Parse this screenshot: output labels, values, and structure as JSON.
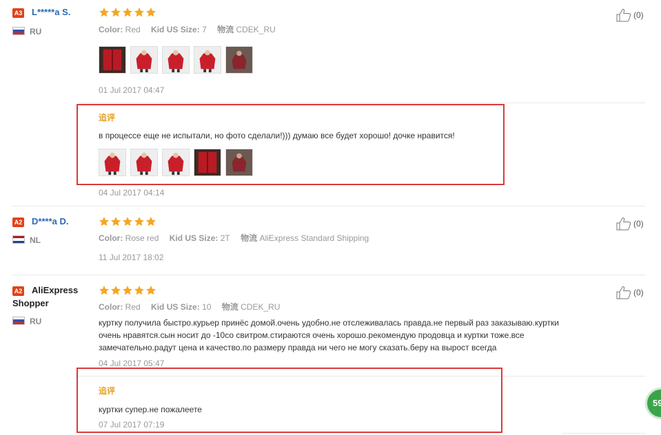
{
  "reviews": [
    {
      "badge": "A3",
      "username": "L*****a S.",
      "country": "RU",
      "meta": {
        "color_label": "Color:",
        "color": "Red",
        "size_label": "Kid US Size:",
        "size": "7",
        "ship_label": "物流",
        "ship": "CDEK_RU"
      },
      "date": "01 Jul 2017 04:47",
      "likes": "(0)",
      "followup": {
        "label": "追评",
        "text": "в процессе еще не испытали, но фото сделали!))) думаю все будет хорошо! дочке нравится!",
        "date": "04 Jul 2017 04:14"
      }
    },
    {
      "badge": "A2",
      "username": "D****a D.",
      "country": "NL",
      "meta": {
        "color_label": "Color:",
        "color": "Rose red",
        "size_label": "Kid US Size:",
        "size": "2T",
        "ship_label": "物流",
        "ship": "AliExpress Standard Shipping"
      },
      "date": "11 Jul 2017 18:02",
      "likes": "(0)"
    },
    {
      "badge": "A2",
      "username_line1": "AliExpress",
      "username_line2": "Shopper",
      "country": "RU",
      "meta": {
        "color_label": "Color:",
        "color": "Red",
        "size_label": "Kid US Size:",
        "size": "10",
        "ship_label": "物流",
        "ship": "CDEK_RU"
      },
      "text_lines": [
        "куртку получила быстро.курьер принёс домой.очень удобно.не отслеживалась правда.не первый раз заказываю.куртки",
        "очень нравятся.сын носит до -10со свитром.стираются очень хорошо.рекомендую продовца и куртки тоже.все",
        "замечательно.радут цена и качество.по размеру правда ни чего не могу сказать.беру на вырост всегда"
      ],
      "date": "04 Jul 2017 05:47",
      "likes": "(0)",
      "followup": {
        "label": "追评",
        "text": "куртки супер.не пожалеете",
        "date": "07 Jul 2017 07:19"
      }
    }
  ],
  "chat_badge": "59",
  "colors": {
    "accent_red": "#d93a3a",
    "star": "#f5a623",
    "link": "#2b69b5",
    "followup": "#e5a021"
  }
}
